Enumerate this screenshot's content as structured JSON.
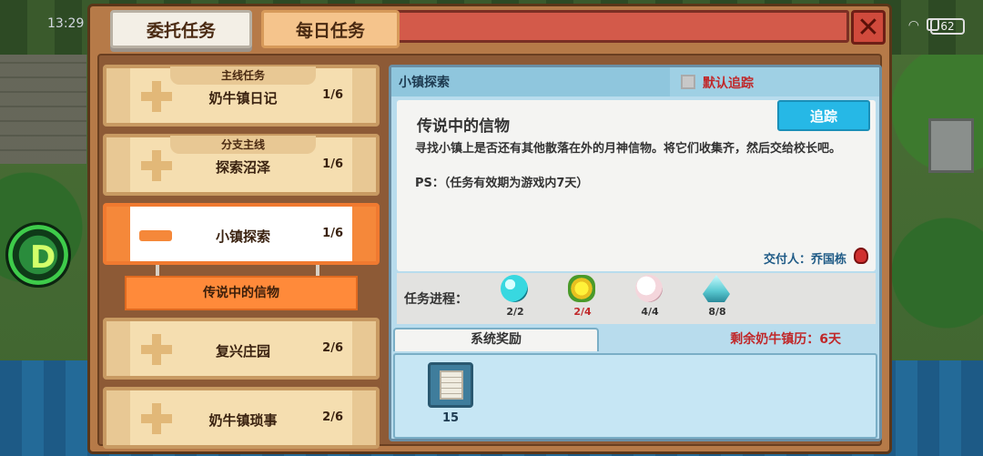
{
  "status_bar": {
    "time": "13:29",
    "battery": "62"
  },
  "tabs": [
    {
      "label": "委托任务",
      "active": true
    },
    {
      "label": "每日任务",
      "active": false
    }
  ],
  "quests": [
    {
      "category": "主线任务",
      "name": "奶牛镇日记",
      "progress": "1/6"
    },
    {
      "category": "分支主线",
      "name": "探索沼泽",
      "progress": "1/6"
    },
    {
      "category": "",
      "name": "小镇探索",
      "progress": "1/6",
      "selected": true
    },
    {
      "category": "",
      "name": "复兴庄园",
      "progress": "2/6"
    },
    {
      "category": "",
      "name": "奶牛镇琐事",
      "progress": "2/6"
    }
  ],
  "selected_subquest": "传说中的信物",
  "detail": {
    "header_title": "小镇探索",
    "default_track_label": "默认追踪",
    "default_track_checked": false,
    "quest_title": "传说中的信物",
    "description": "寻找小镇上是否还有其他散落在外的月神信物。将它们收集齐，然后交给校长吧。",
    "ps": "PS：（任务有效期为游戏内7天）",
    "track_button": "追踪",
    "giver": "交付人：乔国栋",
    "progress_label": "任务进程：",
    "items": [
      {
        "icon": "cyan-orb-icon",
        "count": "2/2",
        "color": "#333333"
      },
      {
        "icon": "yellow-flower-icon",
        "count": "2/4",
        "color": "#c0282a"
      },
      {
        "icon": "cotton-ball-icon",
        "count": "4/4",
        "color": "#333333"
      },
      {
        "icon": "crystal-shard-icon",
        "count": "8/8",
        "color": "#333333"
      }
    ],
    "reward_tab": "系统奖励",
    "remaining": "剩余奶牛镇历：6天",
    "rewards": [
      {
        "icon": "document-icon",
        "count": "15"
      }
    ]
  }
}
